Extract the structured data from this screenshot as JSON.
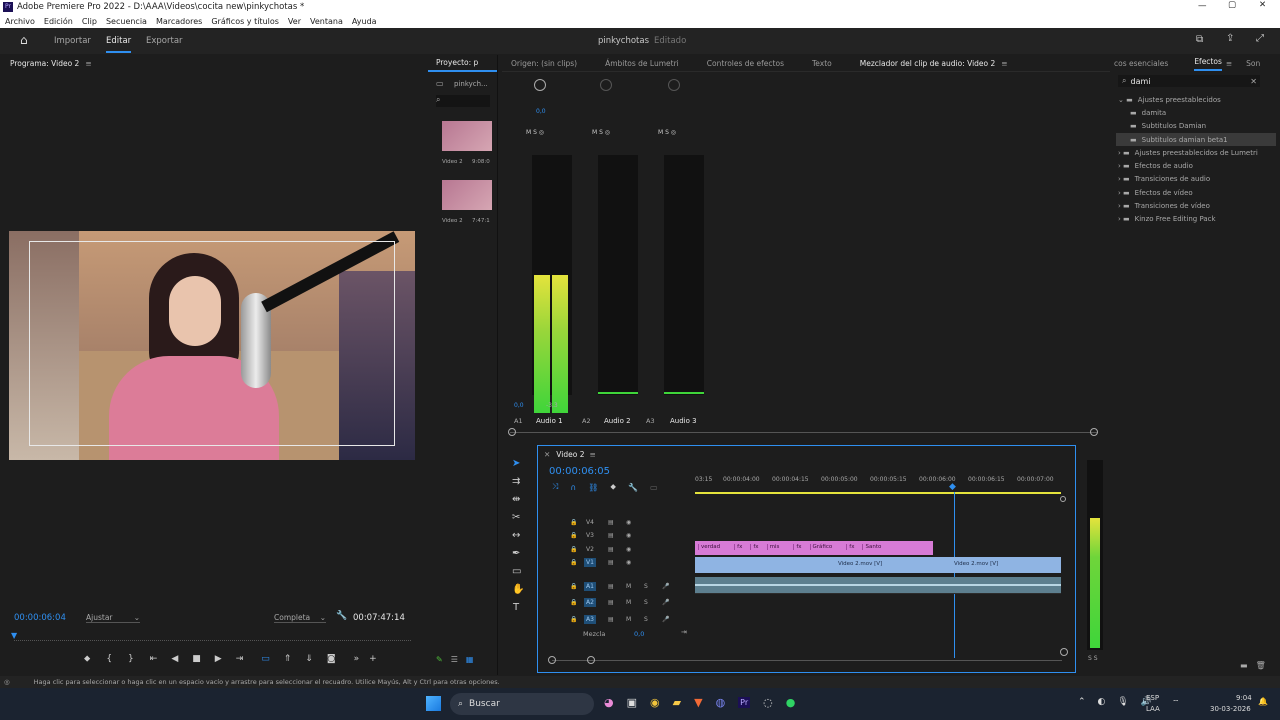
{
  "window": {
    "title": "Adobe Premiere Pro 2022 - D:\\AAA\\Videos\\cocita new\\pinkychotas *"
  },
  "menu": [
    "Archivo",
    "Edición",
    "Clip",
    "Secuencia",
    "Marcadores",
    "Gráficos y títulos",
    "Ver",
    "Ventana",
    "Ayuda"
  ],
  "workspace": {
    "tabs": [
      "Importar",
      "Editar",
      "Exportar"
    ],
    "active": "Editar",
    "project_name": "pinkychotas",
    "status": "Editado"
  },
  "program": {
    "title": "Programa: Video 2",
    "timecode": "00:00:06:04",
    "fit": "Ajustar",
    "quality": "Completa",
    "duration": "00:07:47:14"
  },
  "project": {
    "title": "Proyecto: p",
    "file": "pinkych...",
    "items": [
      {
        "name": "Video 2",
        "dur": "9:08:0"
      },
      {
        "name": "Video 2",
        "dur": "7:47:1"
      }
    ]
  },
  "center_tabs": [
    "Origen: (sin clips)",
    "Ámbitos de Lumetri",
    "Controles de efectos",
    "Texto",
    "Mezclador del clip de audio: Video 2"
  ],
  "mixer": {
    "scale": [
      "dB",
      "6",
      "3",
      "0",
      "-1",
      "-2",
      "-3",
      "-4",
      "-5",
      "-7",
      "-10",
      "-13",
      "-15",
      "-18",
      "-20",
      "-25",
      "-30",
      "-37",
      "-48"
    ],
    "channels": [
      {
        "label": "Audio 1",
        "ch": "A1",
        "level": "0,0",
        "peak": "-3,3",
        "fill": 0.58
      },
      {
        "label": "Audio 2",
        "ch": "A2",
        "level": "0,0",
        "peak": "",
        "fill": 0
      },
      {
        "label": "Audio 3",
        "ch": "A3",
        "level": "0,0",
        "peak": "",
        "fill": 0
      }
    ]
  },
  "effects": {
    "tabs": [
      "cos esenciales",
      "Efectos",
      "Son"
    ],
    "search": "dami",
    "tree": [
      {
        "label": "Ajustes preestablecidos",
        "level": 0,
        "open": true
      },
      {
        "label": "damita",
        "level": 1
      },
      {
        "label": "Subtitulos Damian",
        "level": 1
      },
      {
        "label": "Subtitulos damian beta1",
        "level": 1,
        "selected": true
      },
      {
        "label": "Ajustes preestablecidos de Lumetri",
        "level": 0
      },
      {
        "label": "Efectos de audio",
        "level": 0
      },
      {
        "label": "Transiciones de audio",
        "level": 0
      },
      {
        "label": "Efectos de vídeo",
        "level": 0
      },
      {
        "label": "Transiciones de vídeo",
        "level": 0
      },
      {
        "label": "Kinzo Free Editing Pack",
        "level": 0
      }
    ]
  },
  "timeline": {
    "title": "Video 2",
    "timecode": "00:00:06:05",
    "ruler": [
      "03:15",
      "00:00:04:00",
      "00:00:04:15",
      "00:00:05:00",
      "00:00:05:15",
      "00:00:06:00",
      "00:00:06:15",
      "00:00:07:00"
    ],
    "tracks_v": [
      "V4",
      "V3",
      "V2",
      "V1"
    ],
    "tracks_a": [
      "A1",
      "A2",
      "A3"
    ],
    "mix_label": "Mezcla",
    "mix_value": "0,0",
    "v2_clips": [
      "verdad",
      "fx",
      "fx",
      "mis",
      "fx",
      "Gráfico",
      "fx",
      "Santo"
    ],
    "v1_clips": [
      "Video 2.mov [V]",
      "Video 2.mov [V]"
    ]
  },
  "master_meter": {
    "label": "S S",
    "fill": 0.7
  },
  "status_bar": "Haga clic para seleccionar o haga clic en un espacio vacío y arrastre para seleccionar el recuadro. Utilice Mayús, Alt y Ctrl para otras opciones.",
  "taskbar": {
    "search": "Buscar",
    "lang": "ESP",
    "layout": "LAA",
    "time": "9:04",
    "date": "30-03-2026"
  },
  "colors": {
    "accent": "#2f8ff0",
    "clip_pink": "#d77bd6",
    "clip_blue": "#8fb4e3",
    "meter_green": "#3fd53a",
    "meter_yellow": "#e4e33c"
  }
}
